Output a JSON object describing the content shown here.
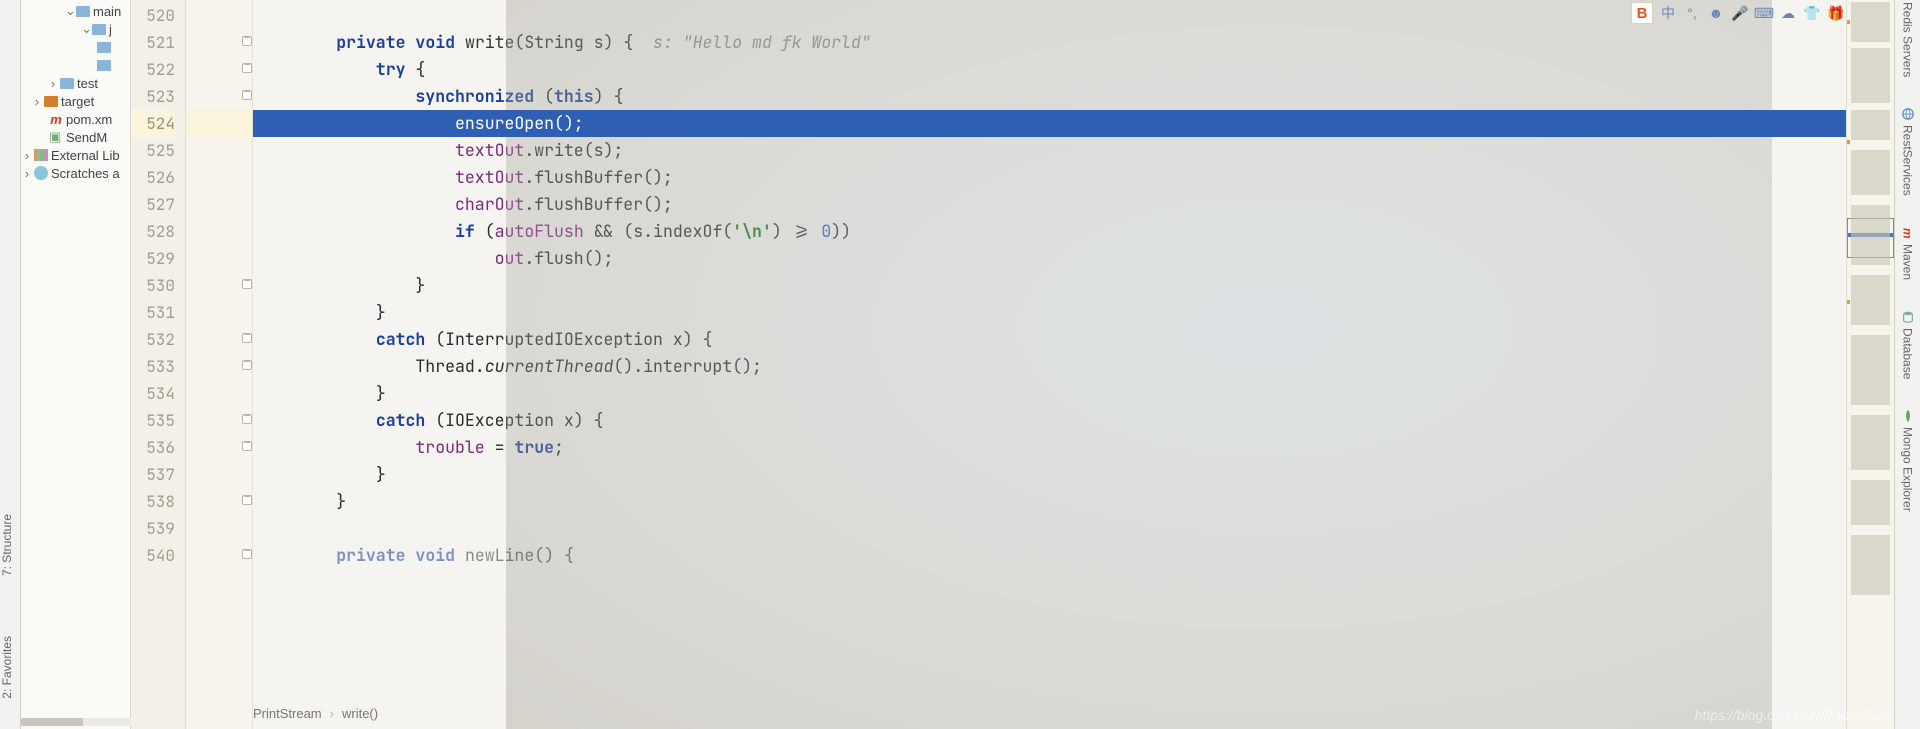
{
  "leftTabs": {
    "structure": "7: Structure",
    "favorites": "2: Favorites"
  },
  "project": {
    "main": "main",
    "j": "j",
    "test": "test",
    "target": "target",
    "pom": "pom.xm",
    "sendM": "SendM",
    "extlib": "External Lib",
    "scratch": "Scratches a"
  },
  "gutter": {
    "start": 520,
    "end": 540,
    "highlighted": 524
  },
  "code": {
    "l520": "",
    "l521": {
      "pre": "        ",
      "kw1": "private",
      "sp1": " ",
      "kw2": "void",
      "sp2": " ",
      "fn": "write",
      "par": "(String s) {",
      "hint": "  s: \"Hello md fk World\""
    },
    "l522": {
      "pre": "            ",
      "kw": "try",
      "rest": " {"
    },
    "l523": {
      "pre": "                ",
      "kw": "synchronized",
      "mid": " (",
      "this": "this",
      "rest": ") {"
    },
    "l524": {
      "pre": "                    ",
      "call": "ensureOpen();"
    },
    "l525": {
      "pre": "                    ",
      "f": "textOut",
      "m": ".write(",
      "a": "s",
      "r": ");"
    },
    "l526": {
      "pre": "                    ",
      "f": "textOut",
      "m": ".flushBuffer();"
    },
    "l527": {
      "pre": "                    ",
      "f": "charOut",
      "m": ".flushBuffer();"
    },
    "l528": {
      "pre": "                    ",
      "kw": "if",
      "mid": " (",
      "f": "autoFlush",
      "op": " && (",
      "a": "s",
      "m2": ".indexOf(",
      "str": "'\\n'",
      "m3": ") >= ",
      "num": "0",
      "r": "))"
    },
    "l529": {
      "pre": "                        ",
      "f": "out",
      "m": ".flush();"
    },
    "l530": {
      "pre": "                ",
      "b": "}"
    },
    "l531": {
      "pre": "            ",
      "b": "}"
    },
    "l532": {
      "pre": "            ",
      "kw": "catch",
      "rest": " (InterruptedIOException x) {"
    },
    "l533": {
      "pre": "                ",
      "cls": "Thread.",
      "it": "currentThread",
      "rest": "().interrupt();"
    },
    "l534": {
      "pre": "            ",
      "b": "}"
    },
    "l535": {
      "pre": "            ",
      "kw": "catch",
      "rest": " (IOException x) {"
    },
    "l536": {
      "pre": "                ",
      "f": "trouble",
      "mid": " = ",
      "kw": "true",
      "r": ";"
    },
    "l537": {
      "pre": "            ",
      "b": "}"
    },
    "l538": {
      "pre": "        ",
      "b": "}"
    },
    "l539": "",
    "l540": {
      "pre": "        ",
      "kw1": "private",
      "sp": " ",
      "kw2": "void",
      "sp2": " ",
      "fn": "newLine",
      "rest": "() {"
    }
  },
  "breadcrumb": {
    "a": "PrintStream",
    "b": "write()"
  },
  "rightTabs": {
    "redis": "Redis Servers",
    "rest": "RestServices",
    "maven": "Maven",
    "database": "Database",
    "mongo": "Mongo Explorer"
  },
  "topIcons": {
    "b": "B",
    "zhong": "中",
    "smile": "☻",
    "clock": "◷",
    "mic": "🎤",
    "kbd": "⌨",
    "cloud": "☁",
    "shirt": "👕",
    "gift": "🎁"
  },
  "watermark": "https://blog.csdn.net/PaperJack"
}
